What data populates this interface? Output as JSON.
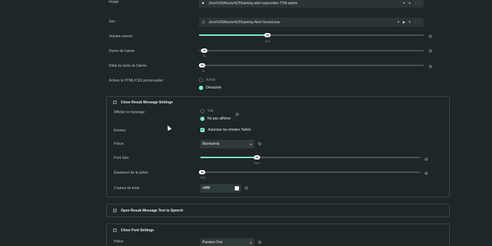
{
  "image": {
    "label": "Image",
    "file": "Zero%20Absolu%20Gaming-alert-subscriber-TYM.webm"
  },
  "sound": {
    "label": "Son",
    "file": "Zero%20Absolu%20Gaming-Alert-Sound.wav"
  },
  "volume": {
    "label": "Volume sonore",
    "value_text": "35%",
    "level": 0.35
  },
  "alert_duration": {
    "label": "Durée de l'alerte",
    "value_text": "9s",
    "level": 0.02
  },
  "text_delay": {
    "label": "Délai du texte de l'alerte",
    "value_text": "1s",
    "level": 0.02
  },
  "custom_html": {
    "label": "Activer le HTML/CSS personnalisé",
    "option_on": "Activé",
    "option_off": "Désactivé",
    "selected": "off"
  },
  "resub_message": {
    "title": "Close Resub Message Settings",
    "show_message": {
      "label": "Afficher le message",
      "option_show": "Voir",
      "option_hide": "Ne pas afficher",
      "selected": "hide"
    },
    "emotes": {
      "label": "Emotes",
      "checkbox_label": "Autoriser les émotes Twitch",
      "checked": true
    },
    "font": {
      "label": "Police",
      "value": "Montserrat"
    },
    "font_size": {
      "label": "Font Size",
      "value_text": "24px",
      "level": 0.29
    },
    "font_weight": {
      "label": "Épaisseur de la police",
      "value_text": "100",
      "level": 0.0
    },
    "text_color": {
      "label": "Couleur du texte",
      "value": "#ffffff"
    }
  },
  "tts": {
    "title": "Open Resub Message Text to Speech"
  },
  "font_settings": {
    "title": "Close Font Settings",
    "font": {
      "label": "Police",
      "value": "Passion One"
    }
  },
  "colors": {
    "accent": "#80f5d2",
    "background": "#1f2628",
    "field": "#2b3436"
  }
}
